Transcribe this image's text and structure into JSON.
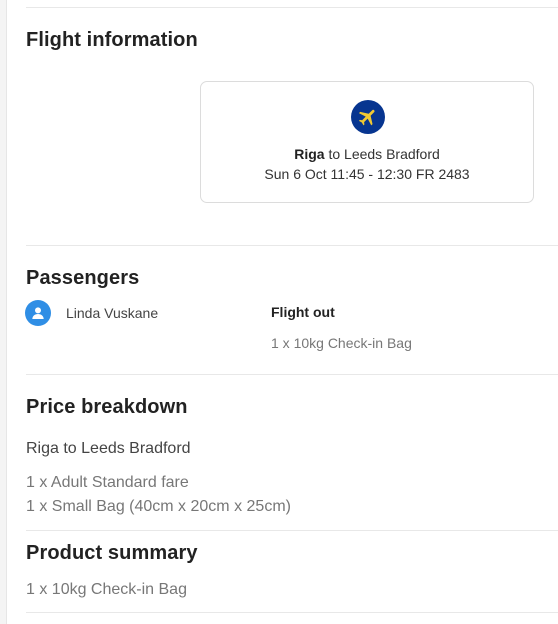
{
  "flight_information": {
    "title": "Flight information",
    "route_origin": "Riga",
    "route_rest": "to Leeds Bradford",
    "time_line": "Sun 6 Oct 11:45 - 12:30 FR 2483",
    "icon": "airplane-icon",
    "badge_color": "#073590",
    "plane_color": "#f1c933"
  },
  "passengers": {
    "title": "Passengers",
    "name": "Linda Vuskane",
    "avatar_icon": "user-icon",
    "avatar_color": "#2f8ee5",
    "flight_out_label": "Flight out",
    "flight_out_item": "1 x 10kg Check-in Bag"
  },
  "price_breakdown": {
    "title": "Price breakdown",
    "route": "Riga to Leeds Bradford",
    "items": [
      "1 x Adult Standard fare",
      "1 x Small Bag (40cm x 20cm x 25cm)"
    ]
  },
  "product_summary": {
    "title": "Product summary",
    "item": "1 x 10kg Check-in Bag"
  }
}
